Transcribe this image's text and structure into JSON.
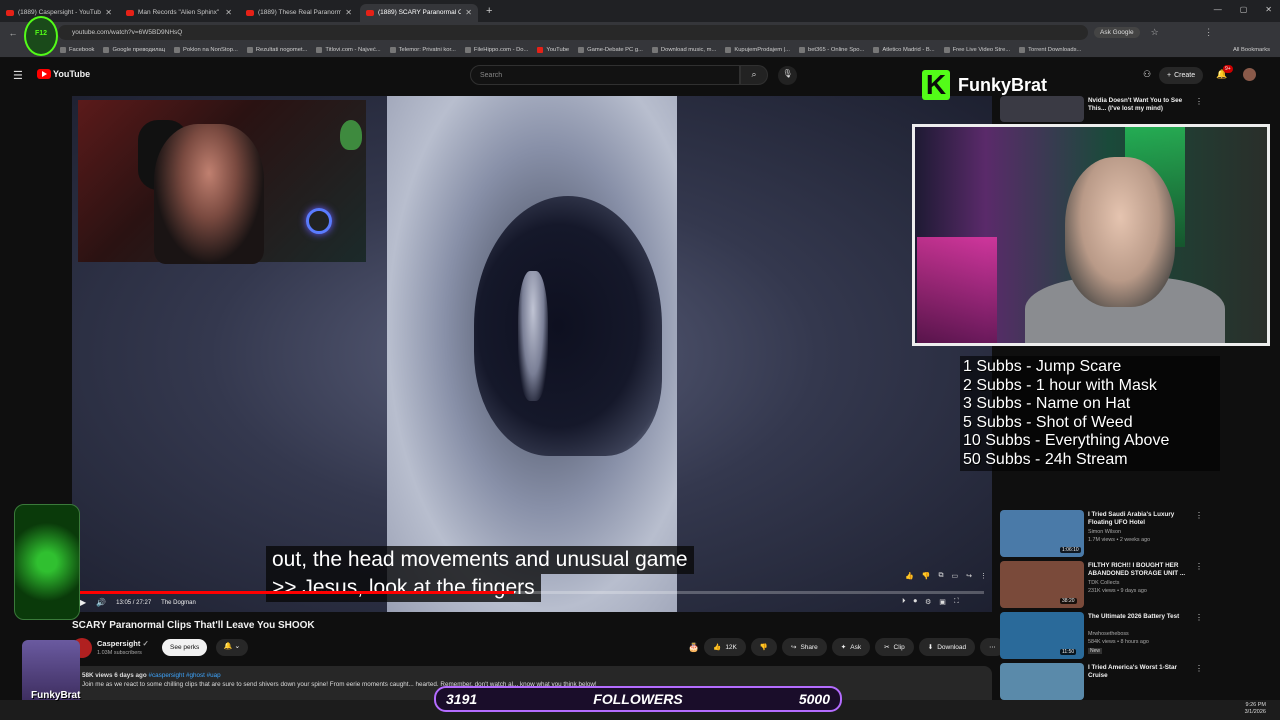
{
  "browser": {
    "tabs": [
      {
        "title": "(1889) Caspersight - YouTube",
        "active": false
      },
      {
        "title": "Man Records \"Alien Sphinx\" Li",
        "active": false
      },
      {
        "title": "(1889) These Real Paranormal",
        "active": false
      },
      {
        "title": "(1889) SCARY Paranormal C",
        "active": true
      }
    ],
    "url": "youtube.com/watch?v=6W5BD9NHsQ",
    "ask_google": "Ask Google",
    "bookmarks": [
      "Facebook",
      "Google преводилац",
      "Poklon na NonStop...",
      "Rezultati nogomet...",
      "Titlovi.com - Najveć...",
      "Telemor: Privatni kor...",
      "FileHippo.com - Do...",
      "YouTube",
      "Game-Debate PC g...",
      "Download music, m...",
      "KupujemProdajem |...",
      "bet365 - Online Spo...",
      "Atletico Madrid - B...",
      "Free Live Video Stre...",
      "Torrent Downloads..."
    ],
    "all_bookmarks": "All Bookmarks"
  },
  "youtube": {
    "logo_text": "YouTube",
    "search_placeholder": "Search",
    "create_label": "Create",
    "notif_count": "9+"
  },
  "player": {
    "captions": [
      "out, the head movements and unusual game",
      ">> Jesus, look at the fingers"
    ],
    "time": "13:05 / 27:27",
    "chapter": "The Dogman",
    "progress": 0.48
  },
  "video": {
    "title": "SCARY Paranormal Clips That'll Leave You SHOOK",
    "channel": "Caspersight",
    "subscribers": "1.03M subscribers",
    "see_perks": "See perks",
    "likes": "12K",
    "share": "Share",
    "ask": "Ask",
    "clip": "Clip",
    "download": "Download",
    "views_date": "58K views  6 days ago",
    "tags": "#caspersight #ghost #uap",
    "description": "Join me as we react to some chilling clips that are sure to send shivers down your spine! From eerie moments caught... hearted. Remember, don't watch al... know what you think below!"
  },
  "recommendations": [
    {
      "title": "Nvidia Doesn't Want You to See This... (I've lost my mind)",
      "channel": "",
      "views": "",
      "duration": "",
      "badge": "",
      "color": "#3a3a44"
    },
    {
      "title": "I Tried Saudi Arabia's Luxury Floating UFO Hotel",
      "channel": "Simon Wilson",
      "views": "1.7M views • 2 weeks ago",
      "duration": "1:06:10",
      "badge": "",
      "color": "#4a7aa8"
    },
    {
      "title": "FILTHY RICH!! I BOUGHT HER ABANDONED STORAGE UNIT ...",
      "channel": "TDK Collects",
      "views": "231K views • 9 days ago",
      "duration": "38:20",
      "badge": "",
      "color": "#7a4a3a"
    },
    {
      "title": "The Ultimate 2026 Battery Test",
      "channel": "Mrwhosetheboss",
      "views": "584K views • 8 hours ago",
      "duration": "11:50",
      "badge": "New",
      "color": "#2a6a9a"
    },
    {
      "title": "I Tried America's Worst 1-Star Cruise",
      "channel": "Simon Wilson",
      "views": "",
      "duration": "",
      "badge": "",
      "color": "#5a8aaa"
    }
  ],
  "stream": {
    "streamer_name": "FunkyBrat",
    "goals": [
      "1 Subbs - Jump Scare",
      "2 Subbs - 1 hour with Mask",
      "3 Subbs - Name on Hat",
      "5 Subbs - Shot of Weed",
      "10 Subbs - Everything Above",
      "50 Subbs - 24h Stream"
    ],
    "followers_current": "3191",
    "followers_label": "FOLLOWERS",
    "followers_goal": "5000",
    "kick_color": "#53fc18"
  },
  "taskbar": {
    "time": "9:26 PM",
    "date": "3/1/2026"
  }
}
